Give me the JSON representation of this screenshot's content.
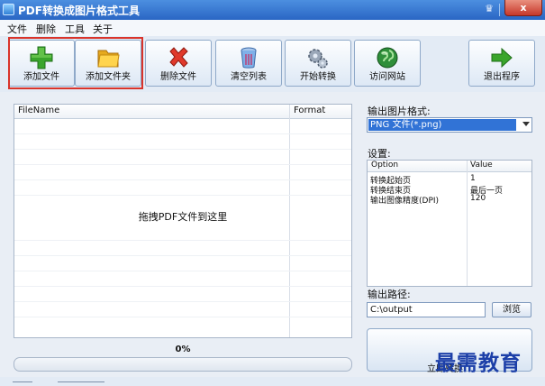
{
  "window": {
    "title": "PDF转换成图片格式工具",
    "close_label": "x",
    "pin_label": "♛"
  },
  "menu": [
    "文件",
    "删除",
    "工具",
    "关于"
  ],
  "toolbar": {
    "add_file": "添加文件",
    "add_folder": "添加文件夹",
    "delete_file": "删除文件",
    "clear_list": "清空列表",
    "start_convert": "开始转换",
    "visit_site": "访问网站",
    "exit": "退出程序"
  },
  "file_list": {
    "columns": [
      "FileName",
      "Format"
    ],
    "drop_hint": "拖拽PDF文件到这里"
  },
  "progress": {
    "label": "0%",
    "value": 0
  },
  "output_format": {
    "label": "输出图片格式:",
    "selected": "PNG 文件(*.png)"
  },
  "settings": {
    "label": "设置:",
    "columns": [
      "Option",
      "Value"
    ],
    "rows": [
      {
        "option": "转换起始页",
        "value": "1"
      },
      {
        "option": "转换结束页",
        "value": "最后一页"
      },
      {
        "option": "输出图像精度(DPI)",
        "value": "120"
      }
    ]
  },
  "output_path": {
    "label": "输出路径:",
    "value": "C:\\output",
    "browse_label": "浏览"
  },
  "convert_button": {
    "label": "立即转换"
  },
  "watermark": "最需教育",
  "colors": {
    "titlebar": "#2a66c4",
    "highlight": "#d9342b",
    "selection": "#3173d6"
  }
}
